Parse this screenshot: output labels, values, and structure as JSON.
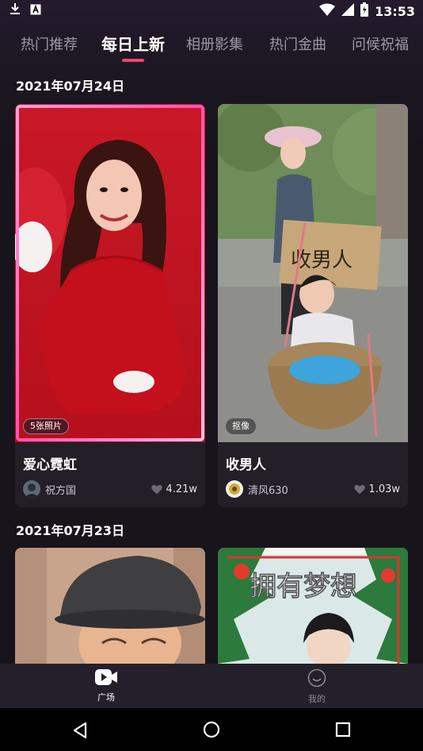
{
  "status_bar": {
    "time": "13:53"
  },
  "tabs": [
    {
      "label": "热门推荐"
    },
    {
      "label": "每日上新"
    },
    {
      "label": "相册影集"
    },
    {
      "label": "热门金曲"
    },
    {
      "label": "问候祝福"
    }
  ],
  "active_tab": "每日上新",
  "accent_color": "#f0466a",
  "sections": [
    {
      "date": "2021年07月24日",
      "cards": [
        {
          "title": "爱心霓虹",
          "badge": "5张照片",
          "author": "祝方国",
          "likes": "4.21w"
        },
        {
          "title": "收男人",
          "badge": "抠像",
          "author": "清风630",
          "likes": "1.03w",
          "sign_text": "收男人"
        }
      ]
    },
    {
      "date": "2021年07月23日",
      "cards": [
        {
          "title": ""
        },
        {
          "title": "",
          "overlay_text": "拥有梦想"
        }
      ]
    }
  ],
  "bottom_nav": [
    {
      "label": "广场",
      "icon": "video-icon"
    },
    {
      "label": "我的",
      "icon": "smiley-icon"
    }
  ]
}
